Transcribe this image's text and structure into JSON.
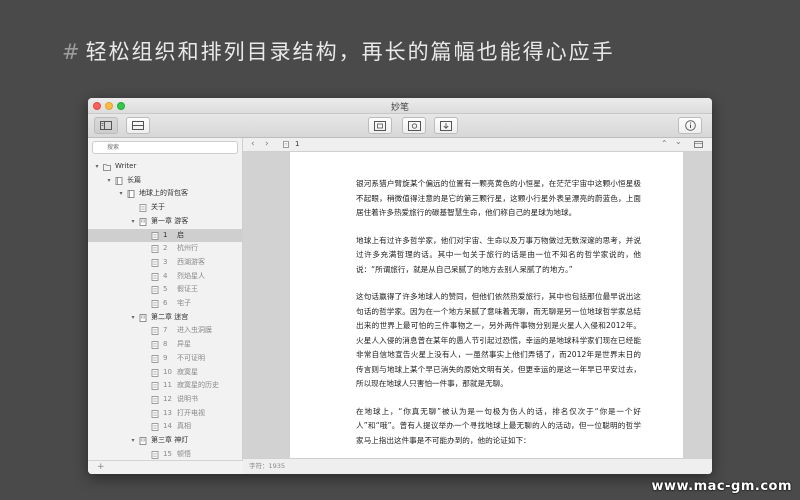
{
  "headline": {
    "hash": "#",
    "text": "轻松组织和排列目录结构，再长的篇幅也能得心应手"
  },
  "window": {
    "title": "妙笔"
  },
  "toolbar": {
    "buttons": [
      "sidebar-toggle",
      "layout",
      "focus",
      "preview",
      "export",
      "info"
    ]
  },
  "sidebar": {
    "search_placeholder": "搜索",
    "add_label": "+",
    "tree": [
      {
        "level": 0,
        "type": "folder",
        "label": "Writer",
        "open": true
      },
      {
        "level": 1,
        "type": "book",
        "label": "长篇",
        "open": true
      },
      {
        "level": 2,
        "type": "book",
        "label": "地球上的背包客",
        "open": true
      },
      {
        "level": 3,
        "type": "doc",
        "label": "关于"
      },
      {
        "level": 3,
        "type": "chapter",
        "label": "第一章  游客",
        "open": true
      },
      {
        "level": 4,
        "type": "doc",
        "num": "1",
        "label": "启",
        "selected": true
      },
      {
        "level": 4,
        "type": "doc",
        "num": "2",
        "label": "杭州行",
        "dim": true
      },
      {
        "level": 4,
        "type": "doc",
        "num": "3",
        "label": "西湖游客",
        "dim": true
      },
      {
        "level": 4,
        "type": "doc",
        "num": "4",
        "label": "烈焰星人",
        "dim": true
      },
      {
        "level": 4,
        "type": "doc",
        "num": "5",
        "label": "假证王",
        "dim": true
      },
      {
        "level": 4,
        "type": "doc",
        "num": "6",
        "label": "宅子",
        "dim": true
      },
      {
        "level": 3,
        "type": "chapter",
        "label": "第二章  迷宫",
        "open": true
      },
      {
        "level": 4,
        "type": "doc",
        "num": "7",
        "label": "进入虫洞膜",
        "dim": true
      },
      {
        "level": 4,
        "type": "doc",
        "num": "8",
        "label": "异星",
        "dim": true
      },
      {
        "level": 4,
        "type": "doc",
        "num": "9",
        "label": "不可证明",
        "dim": true
      },
      {
        "level": 4,
        "type": "doc",
        "num": "10",
        "label": "寂寞星",
        "dim": true
      },
      {
        "level": 4,
        "type": "doc",
        "num": "11",
        "label": "寂寞星的历史",
        "dim": true
      },
      {
        "level": 4,
        "type": "doc",
        "num": "12",
        "label": "说明书",
        "dim": true
      },
      {
        "level": 4,
        "type": "doc",
        "num": "13",
        "label": "打开电视",
        "dim": true
      },
      {
        "level": 4,
        "type": "doc",
        "num": "14",
        "label": "真相",
        "dim": true
      },
      {
        "level": 3,
        "type": "chapter",
        "label": "第三章  神灯",
        "open": true
      },
      {
        "level": 4,
        "type": "doc",
        "num": "15",
        "label": "顿悟",
        "dim": true
      }
    ]
  },
  "editor": {
    "path_label": "1",
    "paragraphs": [
      "银河系猎户臂旋某个偏远的位置有一颗亮黄色的小恒星，在茫茫宇宙中这颗小恒星极不起眼，稍微值得注意的是它的第三颗行星，这颗小行星外表呈漂亮的蔚蓝色，上面居住着许多热爱旅行的碳基智慧生命，他们称自己的星球为地球。",
      "地球上有过许多哲学家，他们对宇宙、生命以及万事万物做过无数深邃的思考，并说过许多充满哲理的话。其中一句关于旅行的话是由一位不知名的哲学家说的，他说：“所谓旅行，就是从自己呆腻了的地方去别人呆腻了的地方。”",
      "这句话赢得了许多地球人的赞同，但他们依然热爱旅行，其中也包括那位最早说出这句话的哲学家。因为在一个地方呆腻了意味着无聊，而无聊是另一位地球哲学家总结出来的世界上最可怕的三件事物之一，另外两件事物分别是火星人入侵和2012年。火星人入侵的消息曾在某年的愚人节引起过恐慌，幸运的是地球科学家们现在已经能非常自信地宣告火星上没有人，一虽然事实上他们弄错了，而2012年是世界末日的传言则与地球上某个早已消失的原始文明有关，但更幸运的是这一年早已平安过去，所以现在地球人只害怕一件事，那就是无聊。",
      "在地球上，“你真无聊”被认为是一句极为伤人的话，排名仅次于“你是一个好人”和“哦”。曾有人提议举办一个寻找地球上最无聊的人的活动，但一位聪明的哲学家马上指出这件事是不可能办到的，他的论证如下："
    ],
    "status": "字符：1935"
  },
  "watermark": "www.mac-gm.com",
  "colors": {
    "background": "#4a4a4a",
    "selected": "#cfcfcf",
    "close": "#fc605c",
    "minimize": "#fdbc40",
    "maximize": "#34c84a"
  }
}
